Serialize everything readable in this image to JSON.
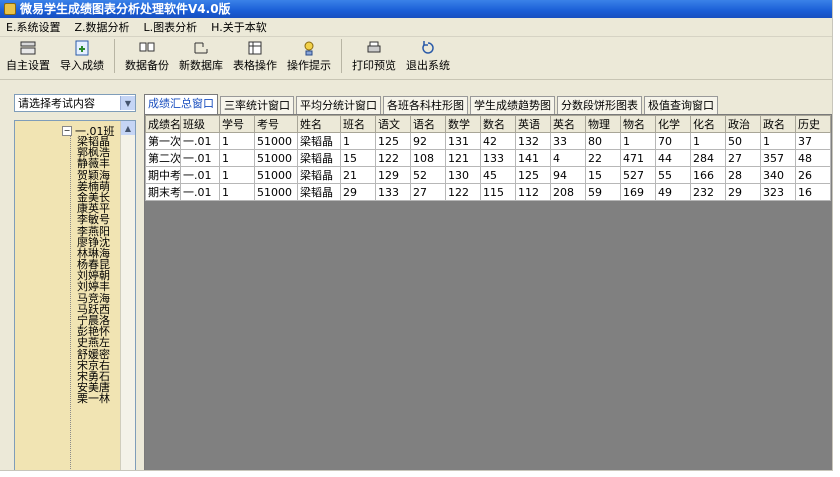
{
  "window": {
    "title": "微易学生成绩图表分析处理软件V4.0版"
  },
  "menu": [
    "E.系统设置",
    "Z.数据分析",
    "L.图表分析",
    "H.关于本软"
  ],
  "toolbar": [
    "自主设置",
    "导入成绩",
    "数据备份",
    "新数据库",
    "表格操作",
    "操作提示",
    "打印预览",
    "退出系统"
  ],
  "left": {
    "combo": "请选择考试内容",
    "tree_root": "一.01班",
    "students": [
      "梁韬晶",
      "郭枫浩",
      "静薇丰",
      "贺颖海",
      "姜楠萌",
      "金美长",
      "康英平",
      "李敏号",
      "李燕阳",
      "廖铮沈",
      "林琳海",
      "杨春昆",
      "刘婷朝",
      "刘婷丰",
      "马竞海",
      "马跃西",
      "宁晨洛",
      "彭艳怀",
      "史燕左",
      "舒媛密",
      "宋京右",
      "宋勇石",
      "安美唐",
      "栗一林"
    ]
  },
  "tabs": [
    "成绩汇总窗口",
    "三率统计窗口",
    "平均分统计窗口",
    "各班各科柱形图",
    "学生成绩趋势图",
    "分数段饼形图表",
    "极值查询窗口"
  ],
  "table": {
    "headers": [
      "成绩名",
      "班级",
      "学号",
      "考号",
      "姓名",
      "班名",
      "语文",
      "语名",
      "数学",
      "数名",
      "英语",
      "英名",
      "物理",
      "物名",
      "化学",
      "化名",
      "政治",
      "政名",
      "历史"
    ],
    "rows": [
      [
        "第一次",
        "一.01",
        "1",
        "51000",
        "梁韬晶",
        "1",
        "125",
        "92",
        "131",
        "42",
        "132",
        "33",
        "80",
        "1",
        "70",
        "1",
        "50",
        "1",
        "37"
      ],
      [
        "第二次",
        "一.01",
        "1",
        "51000",
        "梁韬晶",
        "15",
        "122",
        "108",
        "121",
        "133",
        "141",
        "4",
        "22",
        "471",
        "44",
        "284",
        "27",
        "357",
        "48"
      ],
      [
        "期中考",
        "一.01",
        "1",
        "51000",
        "梁韬晶",
        "21",
        "129",
        "52",
        "130",
        "45",
        "125",
        "94",
        "15",
        "527",
        "55",
        "166",
        "28",
        "340",
        "26"
      ],
      [
        "期末考",
        "一.01",
        "1",
        "51000",
        "梁韬晶",
        "29",
        "133",
        "27",
        "122",
        "115",
        "112",
        "208",
        "59",
        "169",
        "49",
        "232",
        "29",
        "323",
        "16"
      ]
    ]
  },
  "colors": {
    "title_bar": "#1a5ed6",
    "tree_bg": "#f1e4b3",
    "active_tab_text": "#1a4fbf",
    "workspace": "#808080"
  }
}
